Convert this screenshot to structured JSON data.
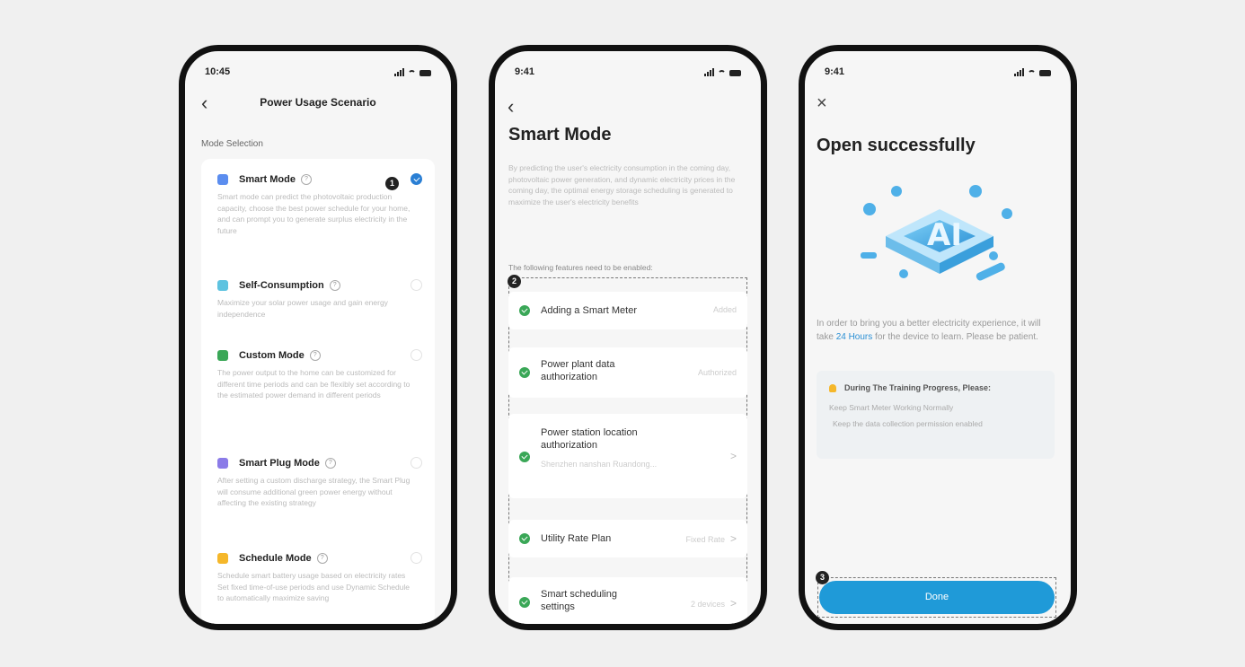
{
  "phone1": {
    "time": "10:45",
    "header_title": "Power Usage Scenario",
    "section_label": "Mode Selection",
    "marker": "1",
    "modes": [
      {
        "title": "Smart Mode",
        "desc": "Smart mode can predict the photovoltaic production capacity, choose the best power schedule for your home, and can prompt you to generate surplus electricity in the future",
        "color": "#5b8def",
        "selected": true
      },
      {
        "title": "Self-Consumption",
        "desc": "Maximize your solar power usage and gain energy independence",
        "color": "#5ec3e0",
        "selected": false
      },
      {
        "title": "Custom Mode",
        "desc": "The power output to the home can be customized for different time periods and can be flexibly set according to the estimated power demand in different periods",
        "color": "#3aa757",
        "selected": false
      },
      {
        "title": "Smart Plug Mode",
        "desc": "After setting a custom discharge strategy, the Smart Plug will consume additional green power energy without affecting the existing strategy",
        "color": "#8b7be8",
        "selected": false
      },
      {
        "title": "Schedule Mode",
        "desc": "Schedule smart battery usage based on electricity rates Set fixed time-of-use periods and use Dynamic Schedule to automatically maximize saving",
        "color": "#f5b72a",
        "selected": false
      }
    ]
  },
  "phone2": {
    "time": "9:41",
    "title": "Smart Mode",
    "description": "By predicting the user's electricity consumption in the coming day, photovoltaic power generation, and dynamic electricity prices in the coming day, the optimal energy storage scheduling is generated to maximize the user's electricity benefits",
    "note": "The following features need to be enabled:",
    "marker": "2",
    "features": [
      {
        "title": "Adding a Smart Meter",
        "value": "Added"
      },
      {
        "title": "Power plant data authorization",
        "value": "Authorized"
      },
      {
        "title": "Power station location authorization",
        "sub": "Shenzhen nanshan Ruandong...",
        "value": "",
        "chevron": ">"
      },
      {
        "title": "Utility Rate Plan",
        "value": "Fixed Rate",
        "chevron": ">"
      },
      {
        "title": "Smart scheduling settings",
        "value": "2 devices",
        "chevron": ">"
      }
    ]
  },
  "phone3": {
    "time": "9:41",
    "close_icon": "×",
    "title": "Open successfully",
    "msg_pre": "In order to bring you a better electricity experience, it will take ",
    "msg_highlight": "24 Hours",
    "msg_post": " for the device to learn. Please be patient.",
    "tip_title": "During The Training Progress, Please:",
    "tip_lines": [
      "Keep Smart Meter Working Normally",
      "Keep the data collection permission enabled"
    ],
    "done_label": "Done",
    "marker": "3",
    "illustration_text": "AI"
  },
  "colors": {
    "accent": "#1f9ad8",
    "success": "#3aa757"
  }
}
